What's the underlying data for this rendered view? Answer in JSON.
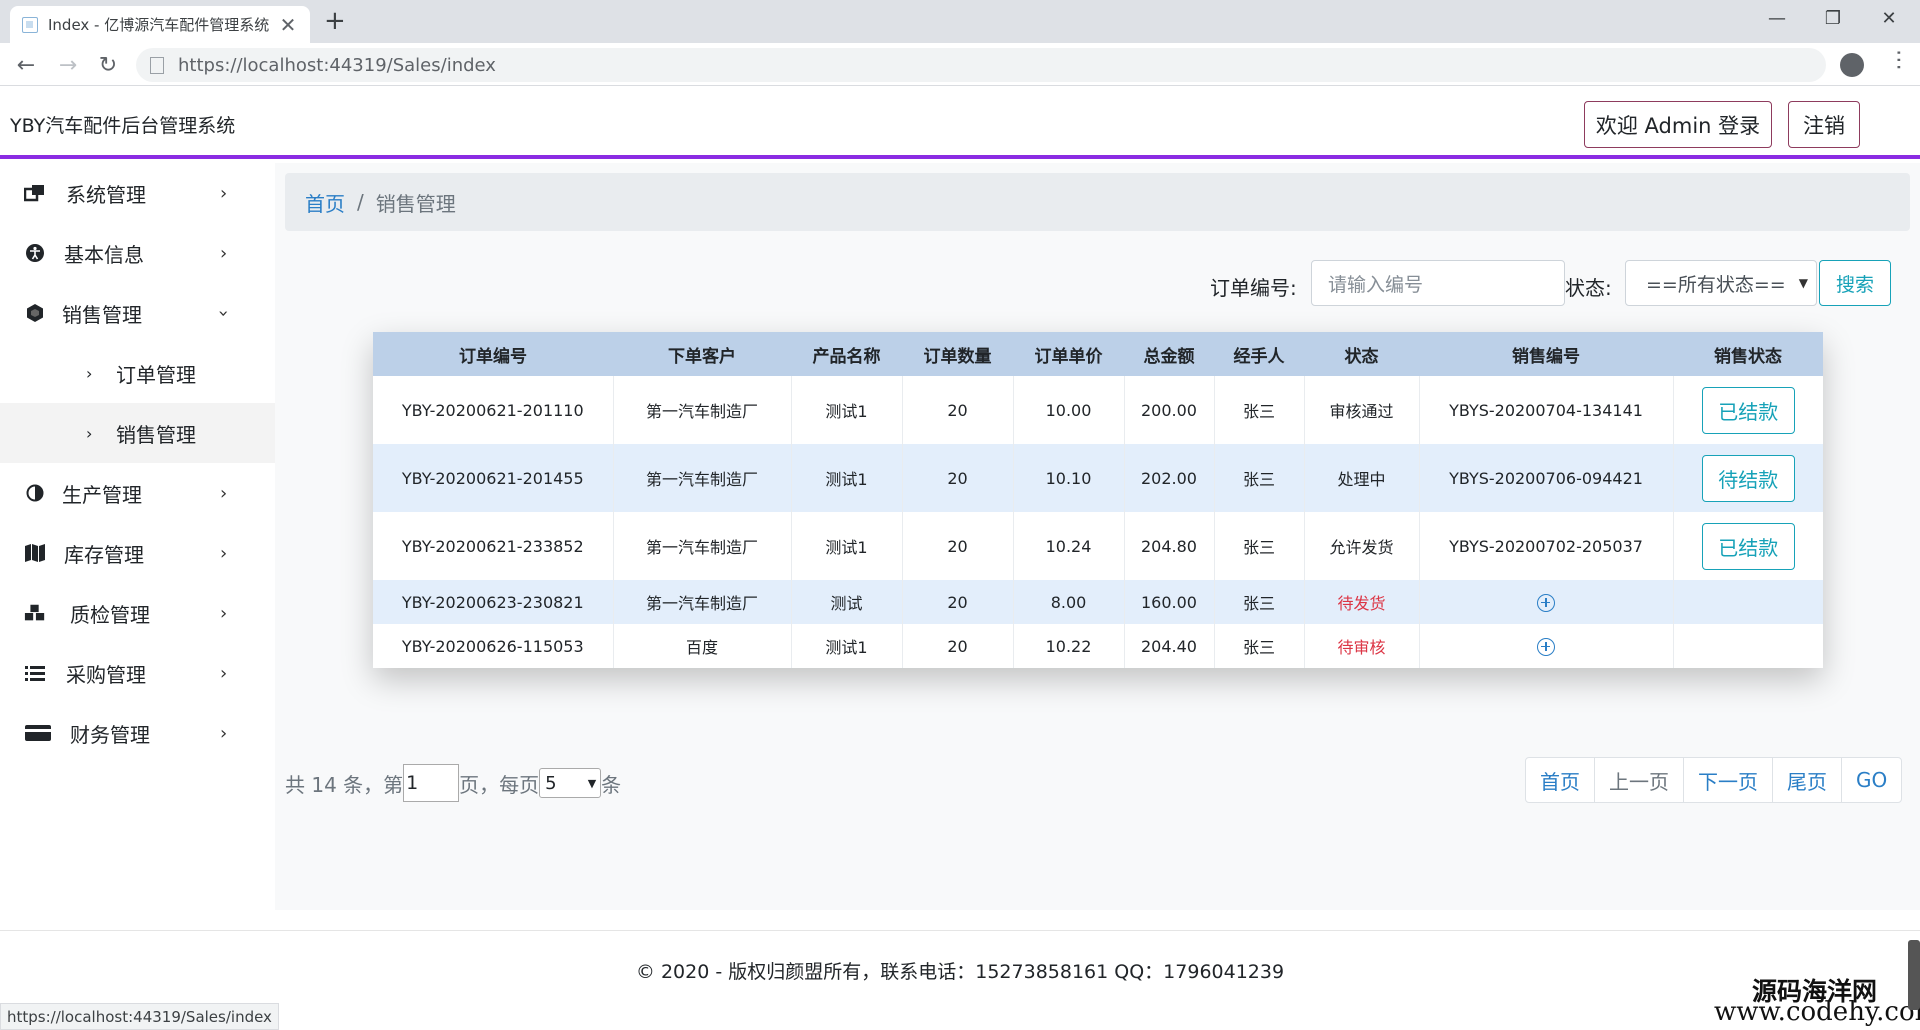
{
  "browser": {
    "tab_title": "Index - 亿博源汽车配件管理系统",
    "url_host": "https://localhost",
    "url_rest": ":44319/Sales/index",
    "status_url": "https://localhost:44319/Sales/index"
  },
  "header": {
    "brand": "YBY汽车配件后台管理系统",
    "welcome_button": "欢迎 Admin 登录",
    "logout_button": "注销"
  },
  "sidebar": {
    "items": [
      {
        "label": "系统管理",
        "icon": "windows-icon"
      },
      {
        "label": "基本信息",
        "icon": "accessibility-icon"
      },
      {
        "label": "销售管理",
        "icon": "hexagon-icon"
      },
      {
        "label": "生产管理",
        "icon": "half-circle-icon"
      },
      {
        "label": "库存管理",
        "icon": "map-icon"
      },
      {
        "label": "质检管理",
        "icon": "cubes-icon"
      },
      {
        "label": "采购管理",
        "icon": "list-icon"
      },
      {
        "label": "财务管理",
        "icon": "credit-card-icon"
      }
    ],
    "subitems": [
      "订单管理",
      "销售管理"
    ]
  },
  "breadcrumb": {
    "home": "首页",
    "current": "销售管理"
  },
  "search": {
    "order_label": "订单编号:",
    "order_placeholder": "请输入编号",
    "status_label": "状态:",
    "status_selected": "==所有状态==",
    "search_button": "搜索"
  },
  "table": {
    "headers": [
      "订单编号",
      "下单客户",
      "产品名称",
      "订单数量",
      "订单单价",
      "总金额",
      "经手人",
      "状态",
      "销售编号",
      "销售状态"
    ],
    "rows": [
      {
        "order_no": "YBY-20200621-201110",
        "customer": "第一汽车制造厂",
        "product": "测试1",
        "qty": "20",
        "price": "10.00",
        "total": "200.00",
        "handler": "张三",
        "status": "审核通过",
        "sale_no": "YBYS-20200704-134141",
        "sale_status": "已结款"
      },
      {
        "order_no": "YBY-20200621-201455",
        "customer": "第一汽车制造厂",
        "product": "测试1",
        "qty": "20",
        "price": "10.10",
        "total": "202.00",
        "handler": "张三",
        "status": "处理中",
        "sale_no": "YBYS-20200706-094421",
        "sale_status": "待结款"
      },
      {
        "order_no": "YBY-20200621-233852",
        "customer": "第一汽车制造厂",
        "product": "测试1",
        "qty": "20",
        "price": "10.24",
        "total": "204.80",
        "handler": "张三",
        "status": "允许发货",
        "sale_no": "YBYS-20200702-205037",
        "sale_status": "已结款"
      },
      {
        "order_no": "YBY-20200623-230821",
        "customer": "第一汽车制造厂",
        "product": "测试",
        "qty": "20",
        "price": "8.00",
        "total": "160.00",
        "handler": "张三",
        "status": "待发货",
        "sale_no": "",
        "sale_status": ""
      },
      {
        "order_no": "YBY-20200626-115053",
        "customer": "百度",
        "product": "测试1",
        "qty": "20",
        "price": "10.22",
        "total": "204.40",
        "handler": "张三",
        "status": "待审核",
        "sale_no": "",
        "sale_status": ""
      }
    ]
  },
  "pagination": {
    "total_prefix": "共 14 条，第",
    "page_value": "1",
    "per_page_prefix": "页，每页",
    "per_page_value": "5",
    "suffix": "条",
    "first": "首页",
    "prev": "上一页",
    "next": "下一页",
    "last": "尾页",
    "go": "GO"
  },
  "footer": {
    "text": "© 2020 - 版权归颜盟所有，联系电话：15273858161 QQ：1796041239"
  },
  "watermark": {
    "line1": "源码海洋网",
    "line2": "www.codehy.com"
  },
  "colors": {
    "accent_purple": "#8a2be2",
    "link_blue": "#2a7ec6",
    "info_teal": "#17a2b8",
    "danger_red": "#dc3545",
    "table_header": "#bcd0e8",
    "row_shade": "#e3eefb"
  }
}
